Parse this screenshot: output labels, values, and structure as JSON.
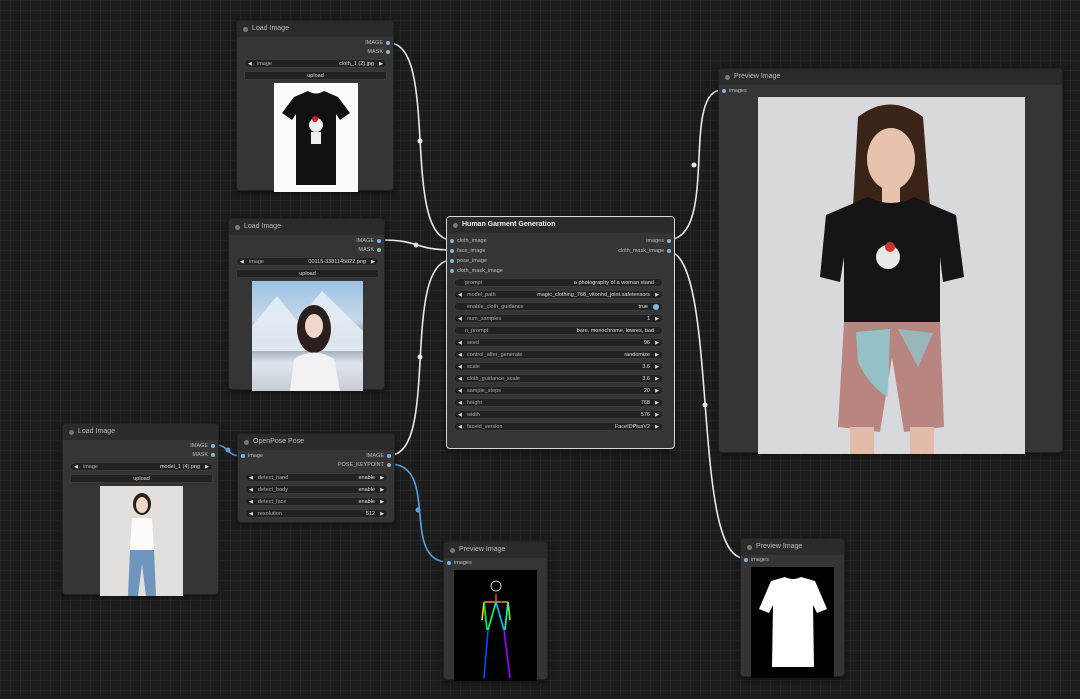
{
  "load_image_1": {
    "title": "Load Image",
    "out_image": "IMAGE",
    "out_mask": "MASK",
    "image_label": "image",
    "image_value": "cloth_1 (2).jpg",
    "upload_label": "upload"
  },
  "load_image_2": {
    "title": "Load Image",
    "out_image": "IMAGE",
    "out_mask": "MASK",
    "image_label": "image",
    "image_value": "00115-3381145822.png",
    "upload_label": "upload"
  },
  "load_image_3": {
    "title": "Load Image",
    "out_image": "IMAGE",
    "out_mask": "MASK",
    "image_label": "image",
    "image_value": "model_1 (4).png",
    "upload_label": "upload"
  },
  "openpose": {
    "title": "OpenPose Pose",
    "in_image": "image",
    "out_image": "IMAGE",
    "out_keypoint": "POSE_KEYPOINT",
    "widgets": [
      {
        "label": "detect_hand",
        "value": "enable"
      },
      {
        "label": "detect_body",
        "value": "enable"
      },
      {
        "label": "detect_face",
        "value": "enable"
      },
      {
        "label": "resolution",
        "value": "512"
      }
    ]
  },
  "hgg": {
    "title": "Human Garment Generation",
    "inputs": [
      "cloth_image",
      "face_image",
      "pose_image",
      "cloth_mask_image"
    ],
    "outputs": [
      "images",
      "cloth_mask_image"
    ],
    "prompt_label": "prompt",
    "prompt_value": "a photography of a woman stand",
    "model_path_label": "model_path",
    "model_path_value": "magic_clothing_768_vitonhd_joint.safetensors",
    "enable_label": "enable_cloth_guidance",
    "enable_value": "true",
    "num_samples_label": "num_samples",
    "num_samples_value": "1",
    "n_prompt_label": "n_prompt",
    "n_prompt_value": "bare, monochrome, lowres, bad",
    "widgets": [
      {
        "label": "seed",
        "value": "96"
      },
      {
        "label": "control_after_generate",
        "value": "randomize"
      },
      {
        "label": "scale",
        "value": "3.6"
      },
      {
        "label": "cloth_guidance_scale",
        "value": "3.6"
      },
      {
        "label": "sample_steps",
        "value": "20"
      },
      {
        "label": "height",
        "value": "768"
      },
      {
        "label": "width",
        "value": "576"
      },
      {
        "label": "faceid_version",
        "value": "FaceIDPlusV2"
      }
    ]
  },
  "preview_main": {
    "title": "Preview Image",
    "in_images": "images"
  },
  "preview_pose": {
    "title": "Preview Image",
    "in_images": "images"
  },
  "preview_mask": {
    "title": "Preview Image",
    "in_images": "images"
  },
  "colors": {
    "canvas": "#1c1c1c",
    "node": "#353535",
    "link_white": "#e8e8e8",
    "link_blue": "#5aa0dc",
    "slot": "#7fb4e0"
  }
}
